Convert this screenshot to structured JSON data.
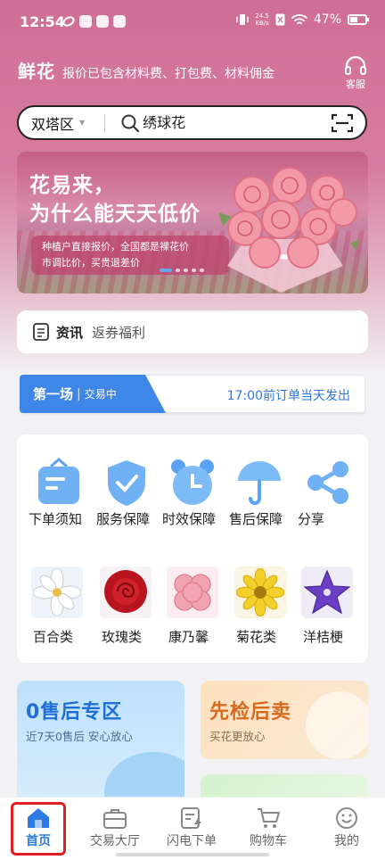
{
  "status_bar": {
    "time": "12:54",
    "net_speed_value": "24.5",
    "net_speed_unit": "KB/s",
    "battery": "47%"
  },
  "header": {
    "title": "鲜花",
    "subtitle": "报价已包含材料费、打包费、材料佣金",
    "service_label": "客服"
  },
  "search": {
    "district": "双塔区",
    "placeholder": "绣球花"
  },
  "banner": {
    "headline_line1": "花易来，",
    "headline_line2": "为什么能天天低价",
    "note_line1": "种植户直接报价，全国都是裸花价",
    "note_line2": "市调比价，买贵退差价",
    "slide_count": 5,
    "active_slide": 1
  },
  "news": {
    "label": "资讯",
    "text": "返券福利"
  },
  "session": {
    "name": "第一场",
    "state": "交易中",
    "note": "17:00前订单当天发出"
  },
  "services": [
    {
      "label": "下单须知",
      "icon": "notice-bag-icon"
    },
    {
      "label": "服务保障",
      "icon": "shield-check-icon"
    },
    {
      "label": "时效保障",
      "icon": "alarm-clock-icon"
    },
    {
      "label": "售后保障",
      "icon": "umbrella-icon"
    },
    {
      "label": "分享",
      "icon": "share-icon"
    }
  ],
  "categories": [
    {
      "label": "百合类",
      "icon": "lily-icon"
    },
    {
      "label": "玫瑰类",
      "icon": "rose-icon"
    },
    {
      "label": "康乃馨",
      "icon": "carnation-icon"
    },
    {
      "label": "菊花类",
      "icon": "chrysanthemum-icon"
    },
    {
      "label": "洋桔梗",
      "icon": "platycodon-icon"
    }
  ],
  "promos": {
    "left_title": "0售后专区",
    "left_sub": "近7天0售后 安心放心",
    "right_title": "先检后卖",
    "right_sub": "买花更放心"
  },
  "bottom_nav": [
    {
      "label": "首页",
      "icon": "home-icon",
      "active": true
    },
    {
      "label": "交易大厅",
      "icon": "briefcase-icon",
      "active": false
    },
    {
      "label": "闪电下单",
      "icon": "flash-order-icon",
      "active": false
    },
    {
      "label": "购物车",
      "icon": "cart-icon",
      "active": false
    },
    {
      "label": "我的",
      "icon": "smile-icon",
      "active": false
    }
  ],
  "colors": {
    "header_pink": "#d06e95",
    "accent_blue": "#2e7be6",
    "promo_blue": "#1d6fd6",
    "promo_orange": "#d86a1e",
    "highlight_red": "#e02020"
  }
}
